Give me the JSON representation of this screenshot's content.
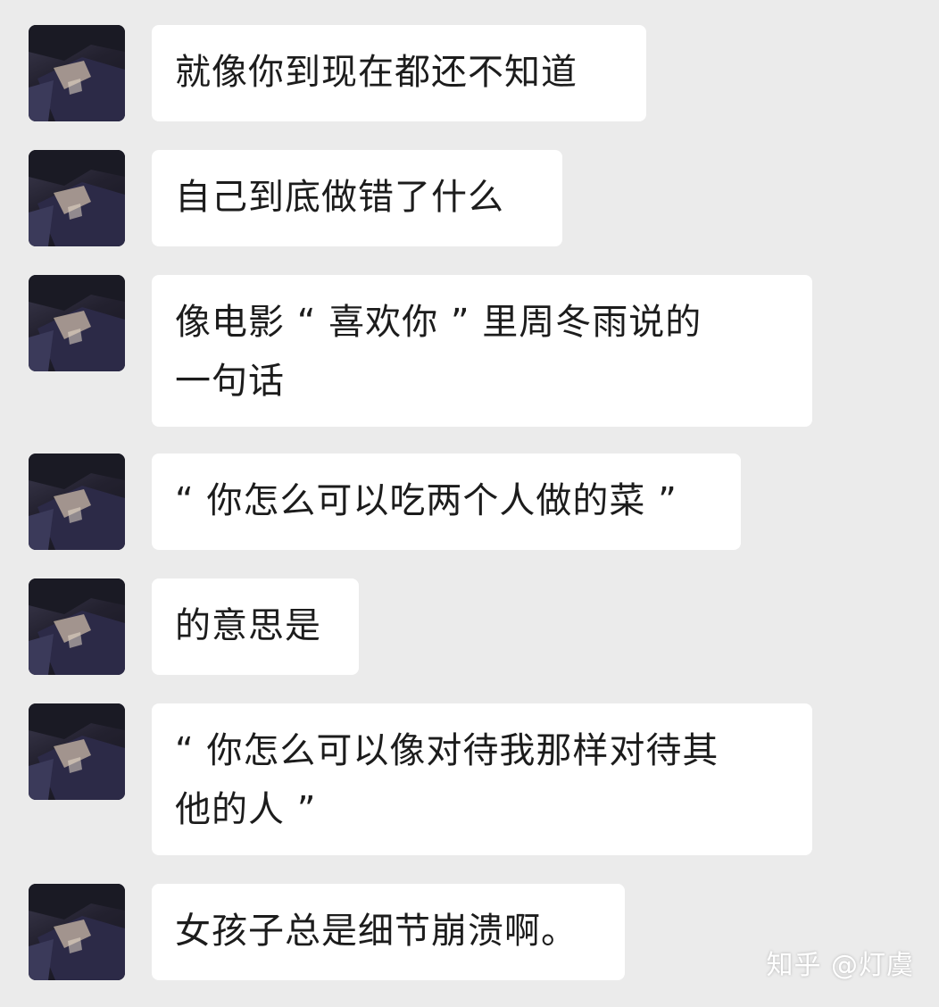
{
  "messages": [
    {
      "text": "就像你到现在都还不知道"
    },
    {
      "text": "自己到底做错了什么"
    },
    {
      "text": "像电影 “ 喜欢你 ” 里周冬雨说的\n一句话"
    },
    {
      "text": "“ 你怎么可以吃两个人做的菜 ”"
    },
    {
      "text": "的意思是"
    },
    {
      "text": "“ 你怎么可以像对待我那样对待其\n他的人 ”"
    },
    {
      "text": "女孩子总是细节崩溃啊。"
    }
  ],
  "watermark": "知乎 @灯虞",
  "colors": {
    "background": "#ebebeb",
    "bubble": "#ffffff",
    "text": "#1c1c1c"
  },
  "icons": {
    "avatar": "anime-character-avatar"
  }
}
